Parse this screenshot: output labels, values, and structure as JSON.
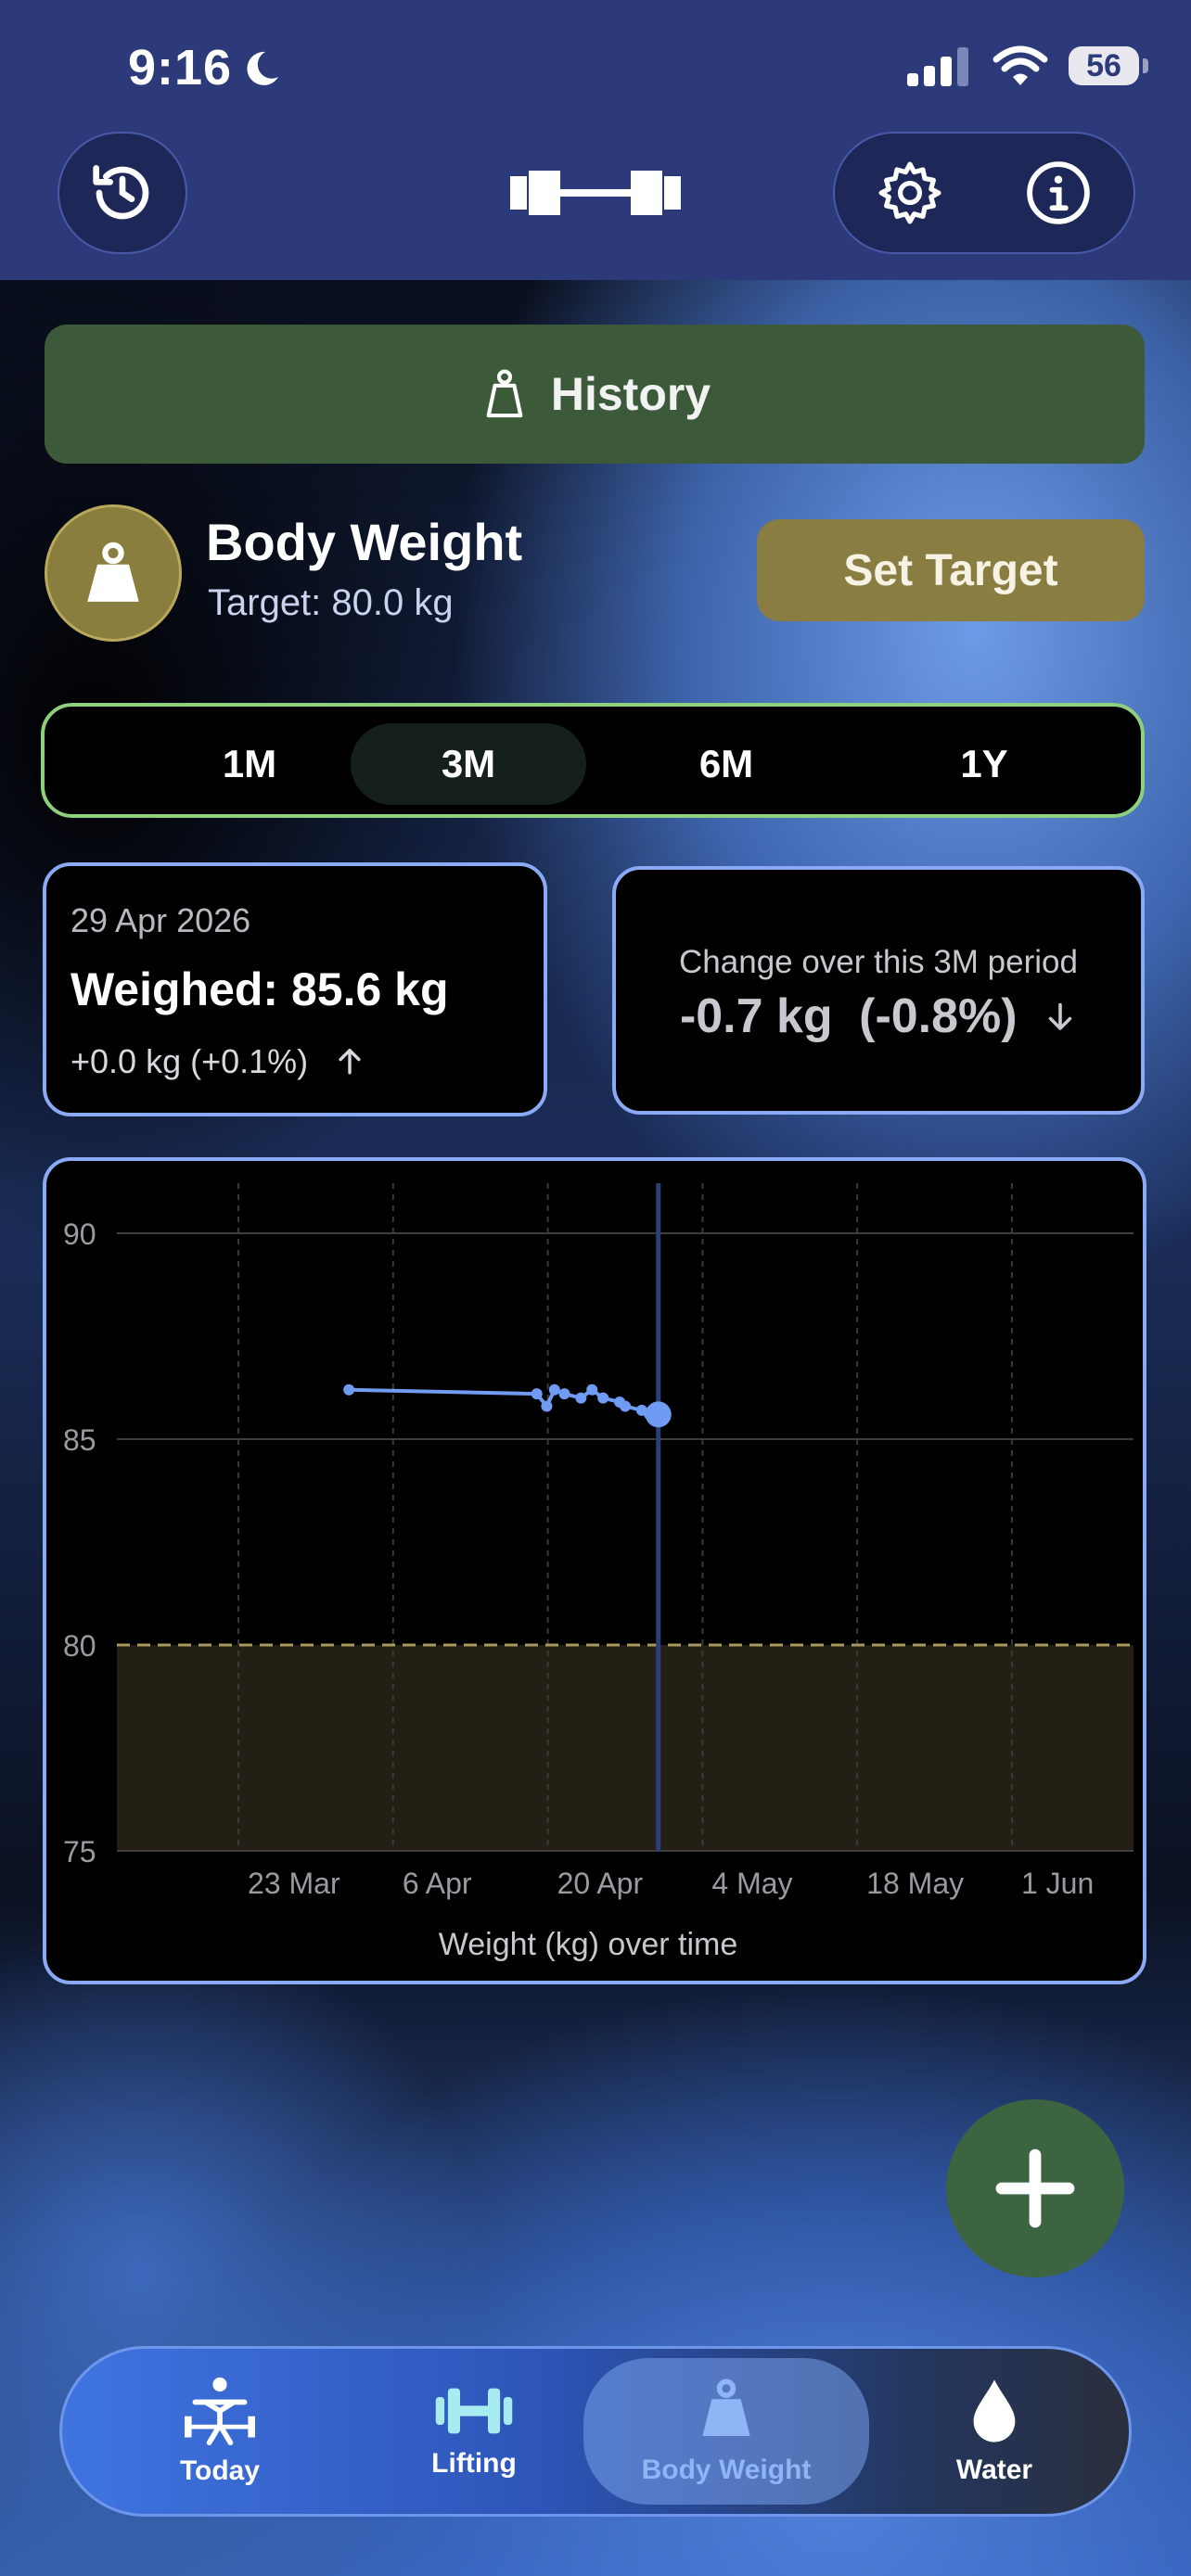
{
  "status": {
    "time": "9:16",
    "battery": "56"
  },
  "header": {
    "history_icon": "history-clock-icon",
    "logo": "barbell-logo",
    "settings_icon": "gear-icon",
    "info_icon": "info-icon"
  },
  "history_button": {
    "label": "History",
    "icon": "weight-icon"
  },
  "body_weight": {
    "title": "Body Weight",
    "target": "Target: 80.0 kg",
    "set_target_label": "Set Target"
  },
  "range": {
    "options": [
      "1M",
      "3M",
      "6M",
      "1Y"
    ],
    "selected": "3M"
  },
  "latest": {
    "date": "29 Apr 2026",
    "weighed": "Weighed: 85.6 kg",
    "delta": "+0.0 kg (+0.1%)"
  },
  "period": {
    "caption": "Change over this 3M period",
    "change": "-0.7 kg",
    "percent": "(-0.8%)"
  },
  "colors": {
    "accent_green": "#8ed07e",
    "card_border": "#8aaaf5",
    "line": "#6f9cf2",
    "target": "#a89a5e"
  },
  "tabs": [
    {
      "label": "Today",
      "icon": "lifter-icon"
    },
    {
      "label": "Lifting",
      "icon": "dumbbell-icon"
    },
    {
      "label": "Body Weight",
      "icon": "weight-icon",
      "active": true
    },
    {
      "label": "Water",
      "icon": "water-drop-icon"
    }
  ],
  "chart_data": {
    "type": "line",
    "xlabel": "Weight (kg) over time",
    "ylim": [
      75,
      90
    ],
    "yticks": [
      90,
      85,
      80,
      75
    ],
    "xticks": [
      "23 Mar",
      "6 Apr",
      "20 Apr",
      "4 May",
      "18 May",
      "1 Jun"
    ],
    "xtick_days": [
      0,
      14,
      28,
      42,
      56,
      70
    ],
    "xlim_days": [
      -11,
      81
    ],
    "target": 80.0,
    "series": [
      {
        "x_dates": [
          "2026-03-32",
          "2026-04-18",
          "2026-04-19",
          "2026-04-20",
          "2026-04-21",
          "2026-04-22",
          "2026-04-23",
          "2026-04-24",
          "2026-04-25",
          "2026-04-26",
          "2026-04-27",
          "2026-04-28",
          "2026-04-29"
        ],
        "x_days": [
          10,
          27,
          27.9,
          28.6,
          29.5,
          31,
          32,
          33,
          34.5,
          35,
          36.5,
          37.2,
          38
        ],
        "values": [
          86.2,
          86.1,
          85.8,
          86.2,
          86.1,
          86.0,
          86.2,
          86.0,
          85.9,
          85.8,
          85.7,
          85.6,
          85.6
        ]
      }
    ],
    "selected_point": {
      "label": "29 Apr 2026",
      "value": 85.6
    }
  }
}
